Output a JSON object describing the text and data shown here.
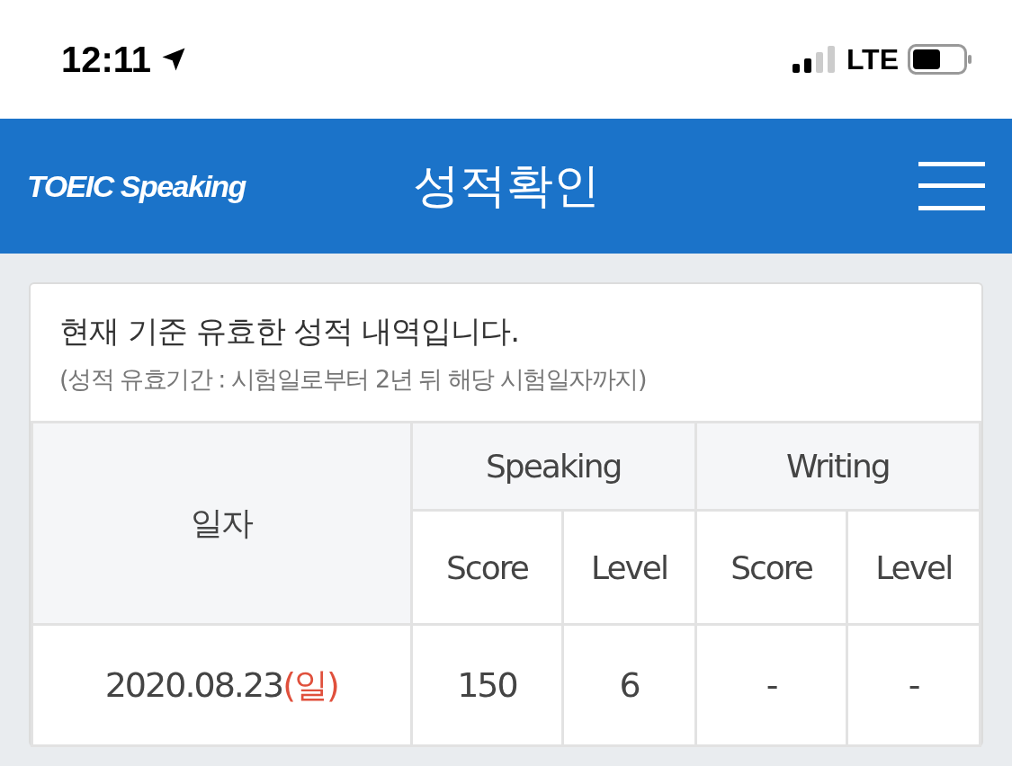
{
  "status_bar": {
    "time": "12:11",
    "network": "LTE"
  },
  "header": {
    "logo": "TOEIC Speaking",
    "title": "성적확인"
  },
  "notice": {
    "title": "현재 기준 유효한 성적 내역입니다.",
    "subtitle": "(성적 유효기간 : 시험일로부터 2년 뒤 해당 시험일자까지)"
  },
  "table": {
    "date_heading": "일자",
    "groups": [
      {
        "name": "Speaking",
        "columns": [
          "Score",
          "Level"
        ]
      },
      {
        "name": "Writing",
        "columns": [
          "Score",
          "Level"
        ]
      }
    ],
    "rows": [
      {
        "date": "2020.08.23",
        "day": "(일)",
        "cells": [
          "150",
          "6",
          "-",
          "-"
        ]
      }
    ]
  }
}
